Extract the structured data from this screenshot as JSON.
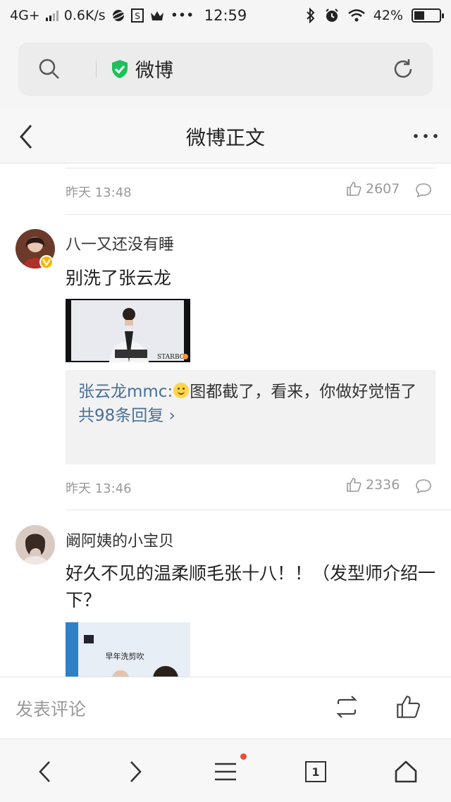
{
  "status_bar": {
    "network": "4G+",
    "speed": "0.6K/s",
    "time": "12:59",
    "battery": "42%",
    "battery_level": 0.42
  },
  "browser": {
    "site_name": "微博",
    "icons": [
      "search-icon",
      "shield-check-icon",
      "refresh-icon"
    ]
  },
  "page_header": {
    "title": "微博正文"
  },
  "comments": [
    {
      "time": "昨天 13:48",
      "likes": "2607"
    },
    {
      "username": "八一又还没有睡",
      "text": "别洗了张云龙",
      "reply_user": "张云龙mmc:",
      "reply_text": "图都截了，看来，你做好觉悟了",
      "reply_count": "共98条回复",
      "time": "昨天 13:46",
      "likes": "2336",
      "image_watermark": "STARBO"
    },
    {
      "username": "阚阿姨的小宝贝",
      "text": "好久不见的温柔顺毛张十八！！（发型师介绍一下？",
      "image_caption": "早年洗剪吹"
    }
  ],
  "comment_bar": {
    "placeholder": "发表评论"
  },
  "nav_bar": {
    "tab_count": "1"
  },
  "colors": {
    "link": "#4a6f97",
    "verified_badge": "#f7b500",
    "shield": "#1ec05a",
    "notification_dot": "#f04b3a"
  }
}
